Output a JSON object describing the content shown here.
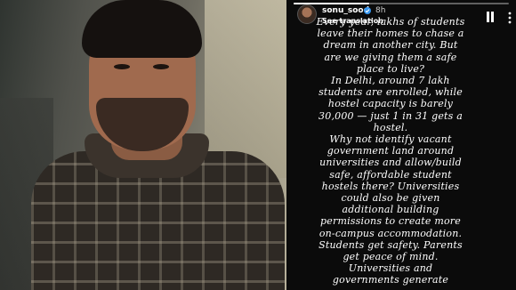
{
  "story": {
    "username": "sonu_sood",
    "time": "8h",
    "translate_label": "See translation",
    "progress": 0.35,
    "body": "Every year, lakhs of students\nleave their homes to chase a\ndream in another city. But\nare we giving them a safe\nplace to live?\nIn Delhi, around 7 lakh\nstudents are enrolled, while\nhostel capacity is barely\n30,000 — just 1 in 31 gets a\nhostel.\nWhy not identify vacant\ngovernment land around\nuniversities and allow/build\nsafe, affordable student\nhostels there? Universities\ncould also be given\nadditional building\npermissions to create more\non-campus accommodation.\nStudents get safety. Parents\nget peace of mind.\nUniversities and\ngovernments generate"
  },
  "icons": {
    "verified": "verified-badge-icon",
    "translate": "translate-icon",
    "pause": "pause-icon",
    "more": "more-vertical-icon",
    "verified_color": "#3897f0"
  }
}
